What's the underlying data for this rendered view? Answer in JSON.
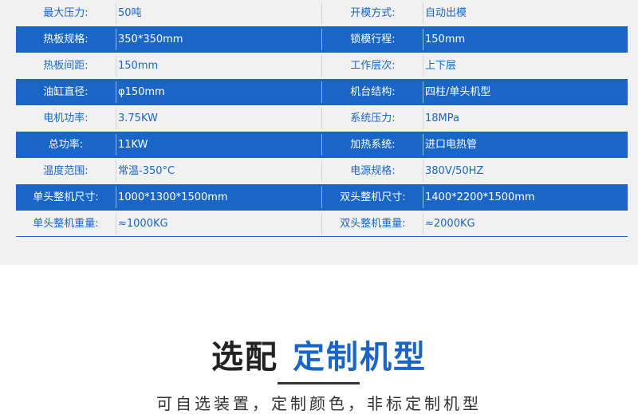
{
  "spec_table": {
    "rows": [
      {
        "label1": "最大压力:",
        "value1": "50吨",
        "label2": "开模方式:",
        "value2": "自动出模"
      },
      {
        "label1": "热板规格:",
        "value1": "350*350mm",
        "label2": "锁模行程:",
        "value2": "150mm"
      },
      {
        "label1": "热板间距:",
        "value1": "150mm",
        "label2": "工作层次:",
        "value2": "上下层"
      },
      {
        "label1": "油缸直径:",
        "value1": "φ150mm",
        "label2": "机台结构:",
        "value2": "四柱/单头机型"
      },
      {
        "label1": "电机功率:",
        "value1": "3.75KW",
        "label2": "系统压力:",
        "value2": "18MPa"
      },
      {
        "label1": "总功率:",
        "value1": "11KW",
        "label2": "加热系统:",
        "value2": "进口电热管"
      },
      {
        "label1": "温度范围:",
        "value1": "常温-350°C",
        "label2": "电源规格:",
        "value2": "380V/50HZ"
      },
      {
        "label1": "单头整机尺寸:",
        "value1": "1000*1300*1500mm",
        "label2": "双头整机尺寸:",
        "value2": "1400*2200*1500mm"
      },
      {
        "label1": "单头整机重量:",
        "value1": "≈1000KG",
        "label2": "双头整机重量:",
        "value2": "≈2000KG"
      }
    ]
  },
  "section": {
    "title_dark": "选配",
    "title_accent": "定制机型",
    "subtitle": "可自选装置，定制颜色，非标定制机型"
  },
  "colors": {
    "accent": "#1a66c8",
    "row_gray": "#f1f1f1",
    "heading_dark": "#222222"
  }
}
